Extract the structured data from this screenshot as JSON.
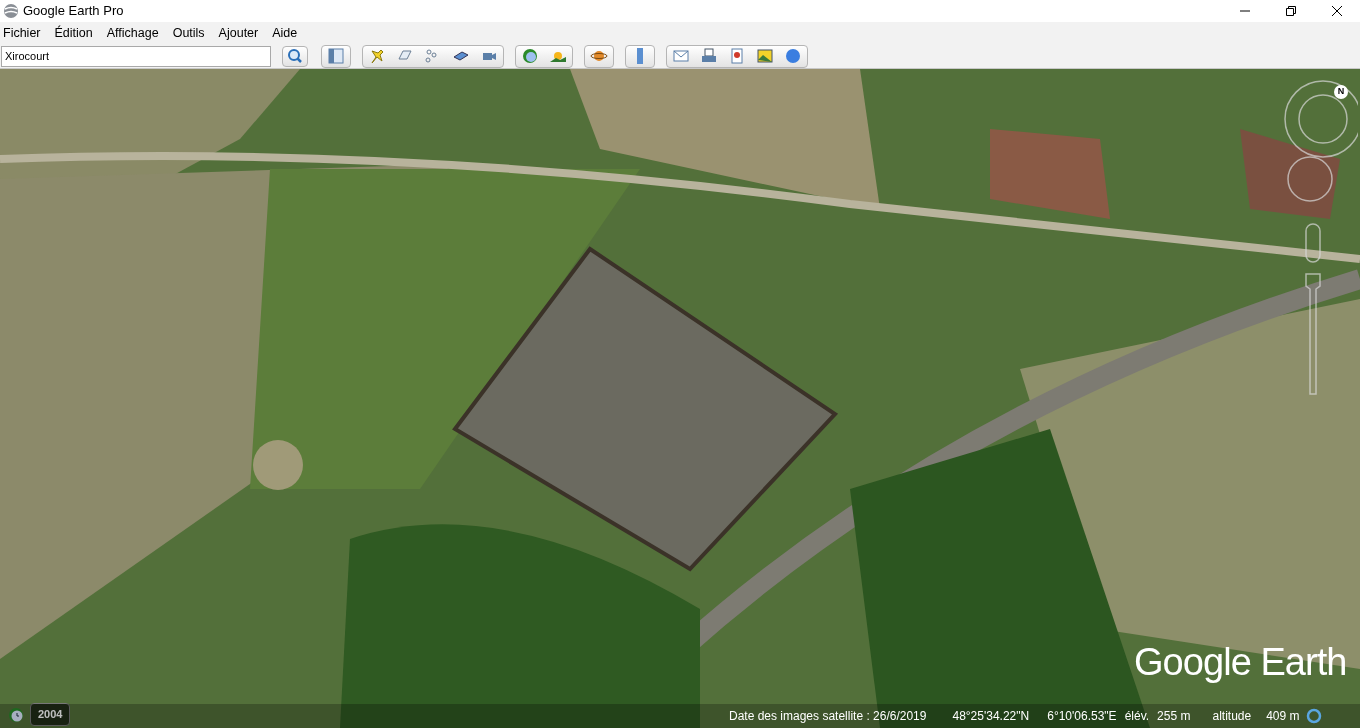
{
  "window": {
    "title": "Google Earth Pro"
  },
  "menu": [
    "Fichier",
    "Édition",
    "Affichage",
    "Outils",
    "Ajouter",
    "Aide"
  ],
  "search": {
    "value": "Xirocourt"
  },
  "map": {
    "logo": "Google Earth",
    "compass": "N"
  },
  "time_badge": "2004",
  "status_bar": {
    "imagery_date": "Date des images satellite : 26/6/2019",
    "latitude": "48°25'34.22\"N",
    "longitude": "6°10'06.53\"E",
    "elevation_label": "élév.",
    "elevation": "255 m",
    "altitude_label": "altitude",
    "altitude": "409 m"
  }
}
